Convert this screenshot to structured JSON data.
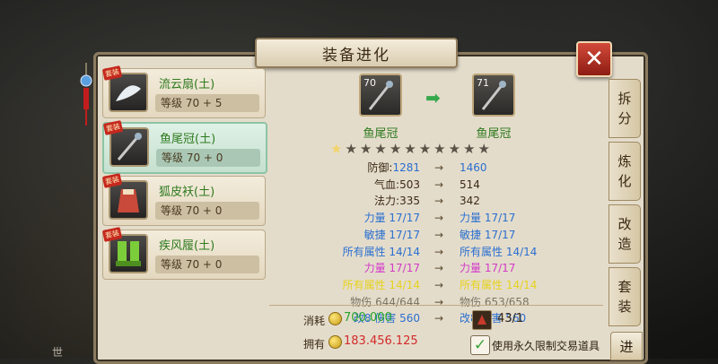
{
  "window": {
    "title": "装备进化",
    "close_icon": "close-icon",
    "close_label": "✕"
  },
  "sidebar": {
    "items": [
      {
        "name": "流云扇(土)",
        "level_text": "等级 70 + 5",
        "badge": "套装",
        "icon": "fan-icon",
        "selected": false
      },
      {
        "name": "鱼尾冠(土)",
        "level_text": "等级 70 + 0",
        "badge": "套装",
        "icon": "staff-icon",
        "selected": true
      },
      {
        "name": "狐皮袄(土)",
        "level_text": "等级 70 + 0",
        "badge": "套装",
        "icon": "robe-icon",
        "selected": false
      },
      {
        "name": "疾风履(土)",
        "level_text": "等级 70 + 0",
        "badge": "套装",
        "icon": "boots-icon",
        "selected": false
      }
    ]
  },
  "evolution": {
    "from": {
      "level": "70",
      "name": "鱼尾冠"
    },
    "to": {
      "level": "71",
      "name": "鱼尾冠"
    },
    "arrow": "➡",
    "stars_total": 11,
    "stars_lit": 1
  },
  "stats": {
    "arrow": "→",
    "rows": [
      {
        "label": "防御:",
        "from": "1281",
        "to": "1460",
        "label_color": "#3b2a16",
        "from_color": "#2a6fd0",
        "to_color": "#2a6fd0"
      },
      {
        "label": "气血:",
        "from": "503",
        "to": "514",
        "label_color": "#3b2a16",
        "from_color": "#3b2a16",
        "to_color": "#3b2a16"
      },
      {
        "label": "法力:",
        "from": "335",
        "to": "342",
        "label_color": "#3b2a16",
        "from_color": "#3b2a16",
        "to_color": "#3b2a16"
      },
      {
        "label": "力量",
        "from": "17/17",
        "to": "力量 17/17",
        "label_color": "#2a6fd0",
        "from_color": "#2a6fd0",
        "to_color": "#2a6fd0"
      },
      {
        "label": "敏捷",
        "from": "17/17",
        "to": "敏捷 17/17",
        "label_color": "#2a6fd0",
        "from_color": "#2a6fd0",
        "to_color": "#2a6fd0"
      },
      {
        "label": "所有属性",
        "from": "14/14",
        "to": "所有属性 14/14",
        "label_color": "#2a6fd0",
        "from_color": "#2a6fd0",
        "to_color": "#2a6fd0"
      },
      {
        "label": "力量",
        "from": "17/17",
        "to": "力量 17/17",
        "label_color": "#d23ac8",
        "from_color": "#d23ac8",
        "to_color": "#d23ac8"
      },
      {
        "label": "所有属性",
        "from": "14/14",
        "to": "所有属性 14/14",
        "label_color": "#e6d21c",
        "from_color": "#e6d21c",
        "to_color": "#e6d21c"
      },
      {
        "label": "物伤",
        "from": "644/644",
        "to": "物伤 653/658",
        "label_color": "#7d7466",
        "from_color": "#7d7466",
        "to_color": "#7d7466"
      },
      {
        "label": "改8 伤害",
        "from": "560",
        "to": "改8 伤害 560",
        "label_color": "#2a6fd0",
        "from_color": "#2a6fd0",
        "to_color": "#2a6fd0"
      }
    ]
  },
  "cost": {
    "consume_label": "消耗",
    "consume_value": "700.000",
    "consume_color": "#27a52b",
    "own_label": "拥有",
    "own_value": "183.456.125",
    "own_color": "#d22a2a",
    "material_icon": "scroll-icon",
    "material_count": "43/1"
  },
  "option": {
    "checked": true,
    "label": "使用永久限制交易道具",
    "check_icon": "checkmark-icon"
  },
  "tabs": [
    {
      "label": "拆分",
      "chars": [
        "拆",
        "分"
      ]
    },
    {
      "label": "炼化",
      "chars": [
        "炼",
        "化"
      ]
    },
    {
      "label": "改造",
      "chars": [
        "改",
        "造"
      ]
    },
    {
      "label": "套装",
      "chars": [
        "套",
        "装"
      ]
    }
  ],
  "evolve_button": {
    "label": "进"
  },
  "corner": {
    "text": "世"
  }
}
